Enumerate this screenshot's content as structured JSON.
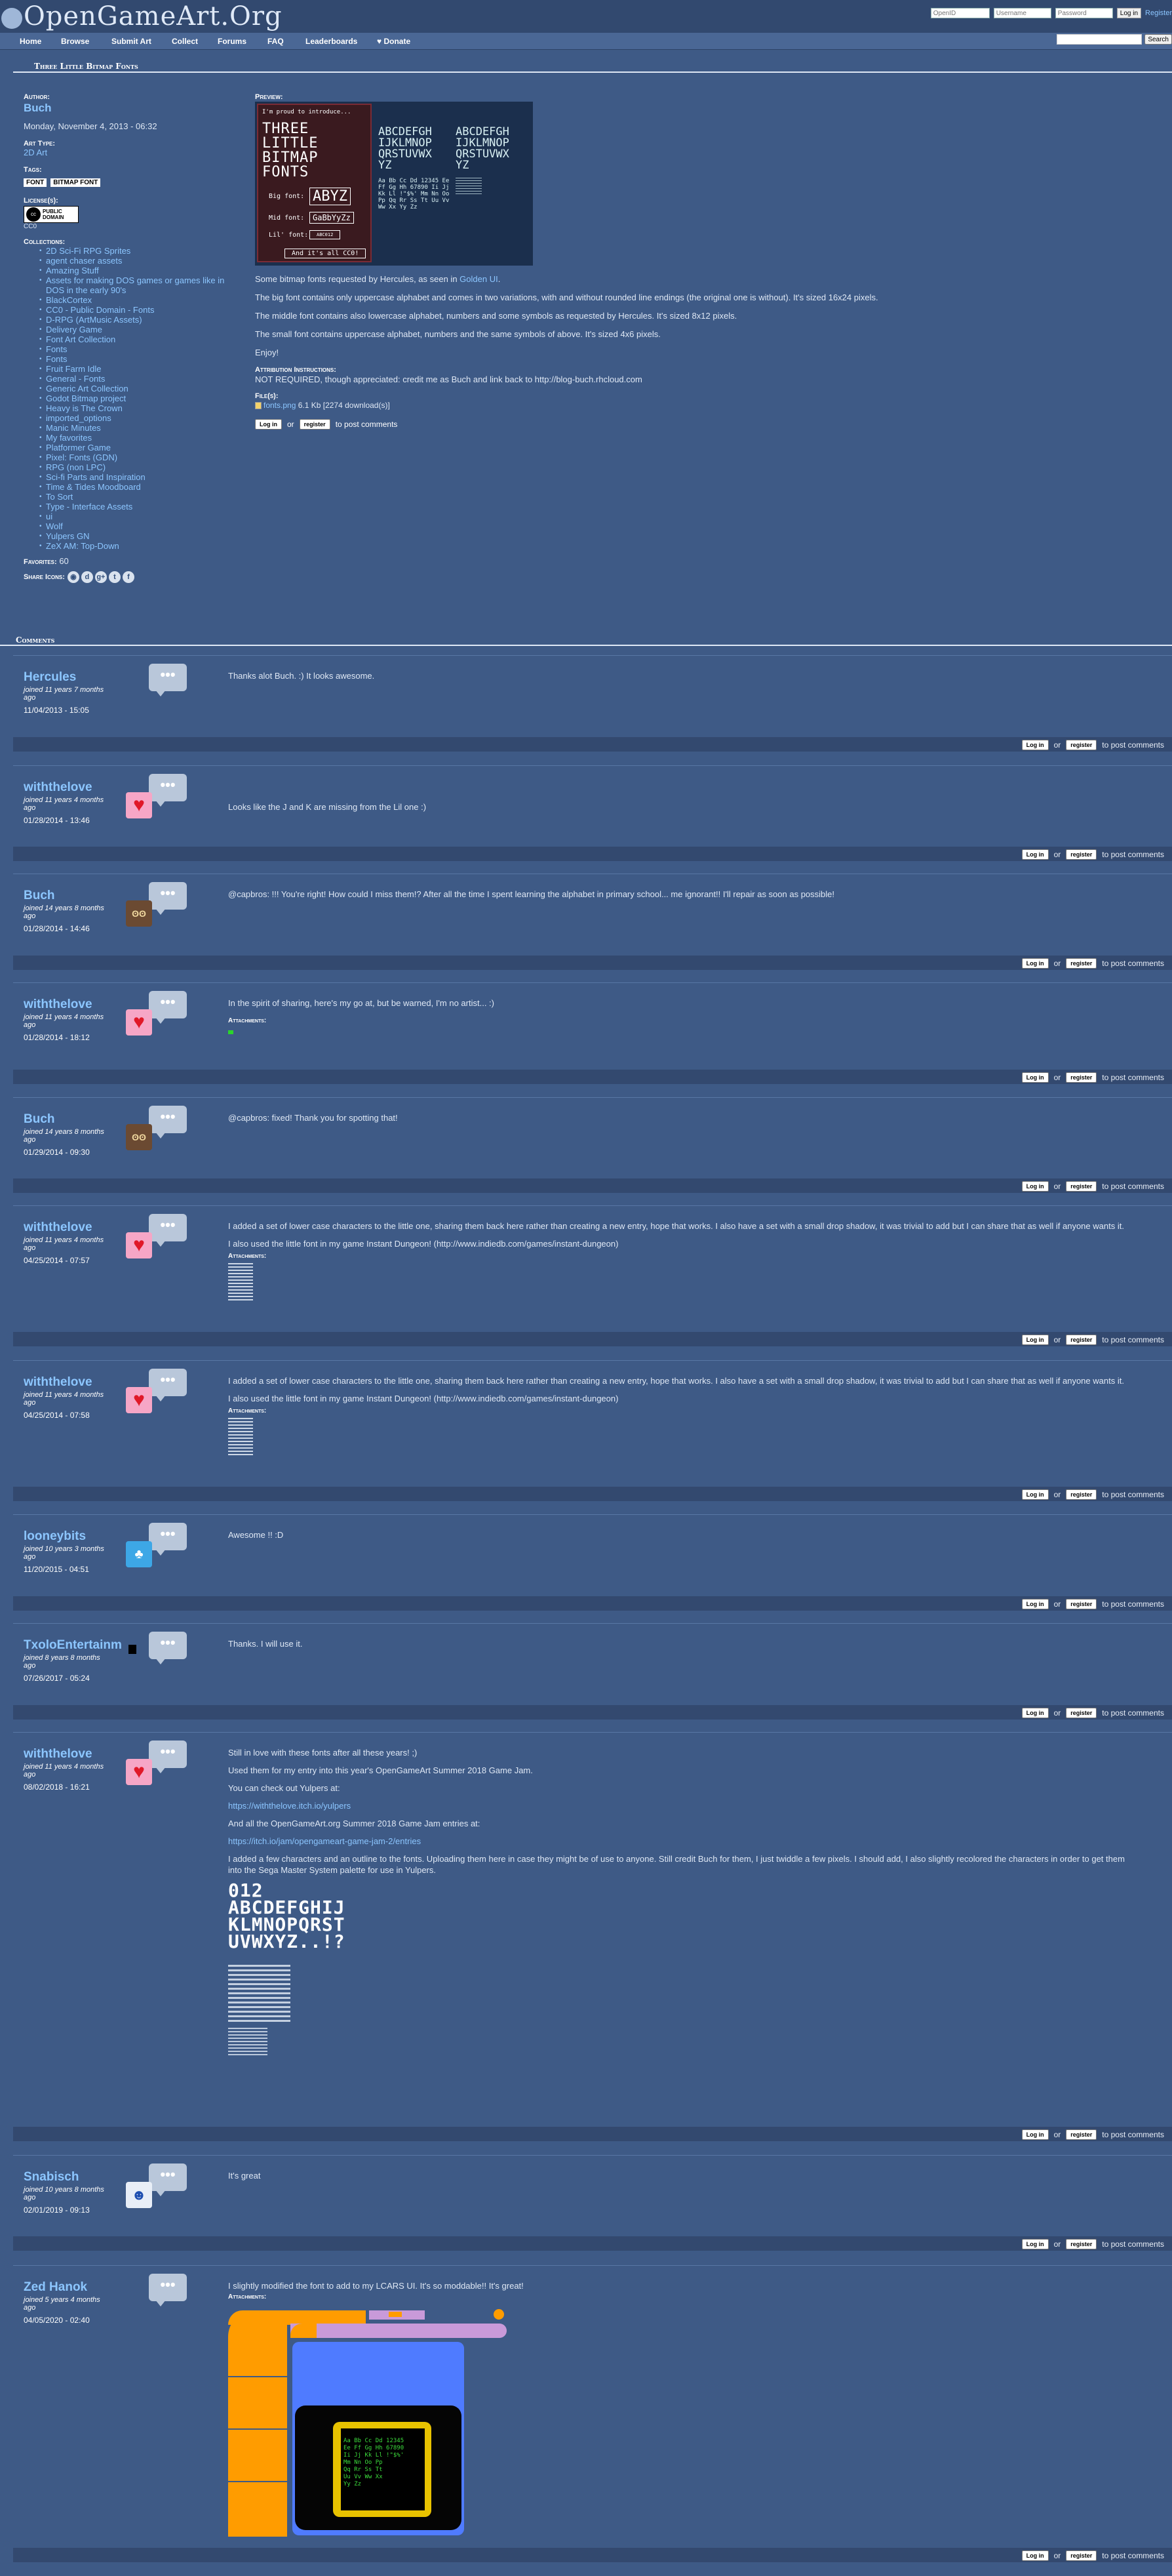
{
  "site": {
    "logo": "OpenGameArt.Org"
  },
  "login": {
    "openid_placeholder": "OpenID",
    "username_placeholder": "Username",
    "password_placeholder": "Password",
    "login_button": "Log in",
    "register": "Register"
  },
  "nav": [
    "Home",
    "Browse",
    "Submit Art",
    "Collect",
    "Forums",
    "FAQ",
    "Leaderboards",
    "♥ Donate"
  ],
  "search": {
    "button": "Search"
  },
  "page_title": "Three Little Bitmap Fonts",
  "sidebar": {
    "author_label": "Author:",
    "author": "Buch",
    "date": "Monday, November 4, 2013 - 06:32",
    "art_type_label": "Art Type:",
    "art_type": "2D Art",
    "tags_label": "Tags:",
    "tags": [
      "FONT",
      "BITMAP FONT"
    ],
    "license_label": "License(s):",
    "license_badge": "PUBLIC DOMAIN",
    "license_name": "CC0",
    "collections_label": "Collections:",
    "collections": [
      "2D Sci-Fi RPG Sprites",
      "agent chaser assets",
      "Amazing Stuff",
      "Assets for making DOS games or games like in DOS in the early 90's",
      "BlackCortex",
      "CC0 - Public Domain - Fonts",
      "D-RPG (ArtMusic Assets)",
      "Delivery Game",
      "Font Art Collection",
      "Fonts",
      "Fonts",
      "Fruit Farm Idle",
      "General - Fonts",
      "Generic Art Collection",
      "Godot Bitmap project",
      "Heavy is The Crown",
      "imported_options",
      "Manic Minutes",
      "My favorites",
      "Platformer Game",
      "Pixel: Fonts (GDN)",
      "RPG (non LPC)",
      "Sci-fi Parts and Inspiration",
      "Time & Tides Moodboard",
      "To Sort",
      "Type - Interface Assets",
      "ui",
      "Wolf",
      "Yulpers GN",
      "ZeX AM: Top-Down"
    ],
    "favorites_label": "Favorites:",
    "favorites": "60",
    "share_label": "Share Icons:"
  },
  "main": {
    "preview_label": "Preview:",
    "preview": {
      "banner_small": "I'm proud to introduce...",
      "banner_big_1": "THREE LITTLE",
      "banner_big_2": "BITMAP FONTS",
      "big_font": "Big font:",
      "big_sample": "ABYZ",
      "mid_font": "Mid font:",
      "mid_sample": "GaBbYyZz",
      "lil_font": "Lil' font:",
      "lil_sample": "ABC012",
      "footer": "And it's all CC0!",
      "grid1_line1": "ABCDEFGH",
      "grid1_line2": "IJKLMNOP",
      "grid1_line3": "QRSTUVWX",
      "grid1_line4": "YZ",
      "grid2_line1": "ABCDEFGH",
      "grid2_line2": "IJKLMNOP",
      "grid2_line3": "QRSTUVWX",
      "grid2_line4": "YZ",
      "grid1_small": "Aa Bb Cc Dd 12345 Ee Ff Gg Hh 67890 Ii Jj Kk Ll !\"$%' Mm Nn Oo Pp Qq Rr Ss Tt Uu Vv Ww Xx Yy Zz"
    },
    "desc_1a": "Some bitmap fonts requested by Hercules, as seen in ",
    "desc_1_link": "Golden UI",
    "desc_1b": ".",
    "desc_2": "The big font contains only uppercase alphabet and comes in two variations, with and without rounded line endings (the original one is without). It's sized 16x24 pixels.",
    "desc_3": "The middle font contains also lowercase alphabet, numbers and some symbols as requested by Hercules. It's sized 8x12 pixels.",
    "desc_4": "The small font contains uppercase alphabet, numbers and the same symbols of above. It's sized 4x6 pixels.",
    "desc_5": "Enjoy!",
    "attribution_label": "Attribution Instructions:",
    "attribution": "NOT REQUIRED, though appreciated: credit me as Buch and link back to http://blog-buch.rhcloud.com",
    "files_label": "File(s):",
    "file_name": "fonts.png",
    "file_info": "6.1 Kb [2274 download(s)]",
    "login_btn": "Log in",
    "or": "or",
    "register_btn": "register",
    "to_post": "to post comments"
  },
  "comments_title": "Comments",
  "comment_footer": {
    "login": "Log in",
    "or": "or",
    "register": "register",
    "to_post": "to post comments"
  },
  "attachments_label": "Attachments:",
  "comments": [
    {
      "author": "Hercules",
      "joined": "joined 11 years 7 months ago",
      "date": "11/04/2013 - 15:05",
      "text": [
        "Thanks alot Buch. :) It looks awesome."
      ]
    },
    {
      "author": "withthelove",
      "joined": "joined 11 years 4 months ago",
      "date": "01/28/2014 - 13:46",
      "text": [
        "Looks like the J and K are missing from the Lil one :)"
      ]
    },
    {
      "author": "Buch",
      "joined": "joined 14 years 8 months ago",
      "date": "01/28/2014 - 14:46",
      "text": [
        "@capbros: !!! You're right! How could I miss them!? After all the time I spent learning the alphabet in primary school... me ignorant!! I'll repair as soon as possible!"
      ]
    },
    {
      "author": "withthelove",
      "joined": "joined 11 years 4 months ago",
      "date": "01/28/2014 - 18:12",
      "text": [
        "In the spirit of sharing, here's my go at, but be warned, I'm no artist... :)"
      ]
    },
    {
      "author": "Buch",
      "joined": "joined 14 years 8 months ago",
      "date": "01/29/2014 - 09:30",
      "text": [
        "@capbros: fixed! Thank you for spotting that!"
      ]
    },
    {
      "author": "withthelove",
      "joined": "joined 11 years 4 months ago",
      "date": "04/25/2014 - 07:57",
      "text": [
        "I added a set of lower case characters to the little one, sharing them back here rather than creating a new entry, hope that works.   I also have a set with a small drop shadow, it was trivial to add but I can share that as well if anyone wants it.",
        "I also used the little font in my game Instant Dungeon! (http://www.indiedb.com/games/instant-dungeon)"
      ]
    },
    {
      "author": "withthelove",
      "joined": "joined 11 years 4 months ago",
      "date": "04/25/2014 - 07:58",
      "text": [
        "I added a set of lower case characters to the little one, sharing them back here rather than creating a new entry, hope that works.   I also have a set with a small drop shadow, it was trivial to add but I can share that as well if anyone wants it.",
        "I also used the little font in my game Instant Dungeon! (http://www.indiedb.com/games/instant-dungeon)"
      ]
    },
    {
      "author": "looneybits",
      "joined": "joined 10 years 3 months ago",
      "date": "11/20/2015 - 04:51",
      "text": [
        "Awesome !! :D"
      ]
    },
    {
      "author": "TxoloEntertainment",
      "joined": "joined 8 years 8 months ago",
      "date": "07/26/2017 - 05:24",
      "text": [
        "Thanks. I will use it."
      ]
    },
    {
      "author": "withthelove",
      "joined": "joined 11 years 4 months ago",
      "date": "08/02/2018 - 16:21",
      "text": [
        "Still in love with these fonts after all these years! ;)",
        "Used them for my entry into this year's OpenGameArt Summer 2018 Game Jam.",
        "You can check out Yulpers at:",
        "https://withthelove.itch.io/yulpers",
        "And all the OpenGameArt.org Summer 2018 Game Jam entries at:",
        "https://itch.io/jam/opengameart-game-jam-2/entries",
        "I added a few characters and an outline to the fonts.  Uploading them here in case they might be of use to anyone.  Still credit Buch for them, I just twiddle a few pixels.  I should add, I also slightly recolored the characters in order to get them into the Sega Master System palette for use in Yulpers."
      ]
    },
    {
      "author": "Snabisch",
      "joined": "joined 10 years 8 months ago",
      "date": "02/01/2019 - 09:13",
      "text": [
        "It's great"
      ]
    },
    {
      "author": "Zed Hanok",
      "joined": "joined 5 years 4 months ago",
      "date": "04/05/2020 - 02:40",
      "text": [
        "I slightly modified the font to add to my LCARS UI. It's so moddable!! It's great!"
      ]
    }
  ],
  "c10_glyphs": {
    "line1": "012",
    "line2": "ABCDEFGHIJ",
    "line3": "KLMNOPQRST",
    "line4": "UVWXYZ..!?"
  },
  "lcars_screen": {
    "l1": "Aa Bb Cc Dd 12345",
    "l2": "Ee Ff Gg Hh 67890",
    "l3": "Ii Jj Kk Ll !\"$%'",
    "l4": "Mm Nn Oo Pp",
    "l5": "Qq Rr Ss Tt",
    "l6": "Uu Vv Ww Xx",
    "l7": "Yy Zz"
  },
  "colors": {
    "background": "#3e5a86",
    "link": "#8cc6ff",
    "header": "#32496f",
    "lcars_orange": "#ff9c00",
    "lcars_blue": "#4f7bff",
    "lcars_purple": "#c99ad9"
  }
}
